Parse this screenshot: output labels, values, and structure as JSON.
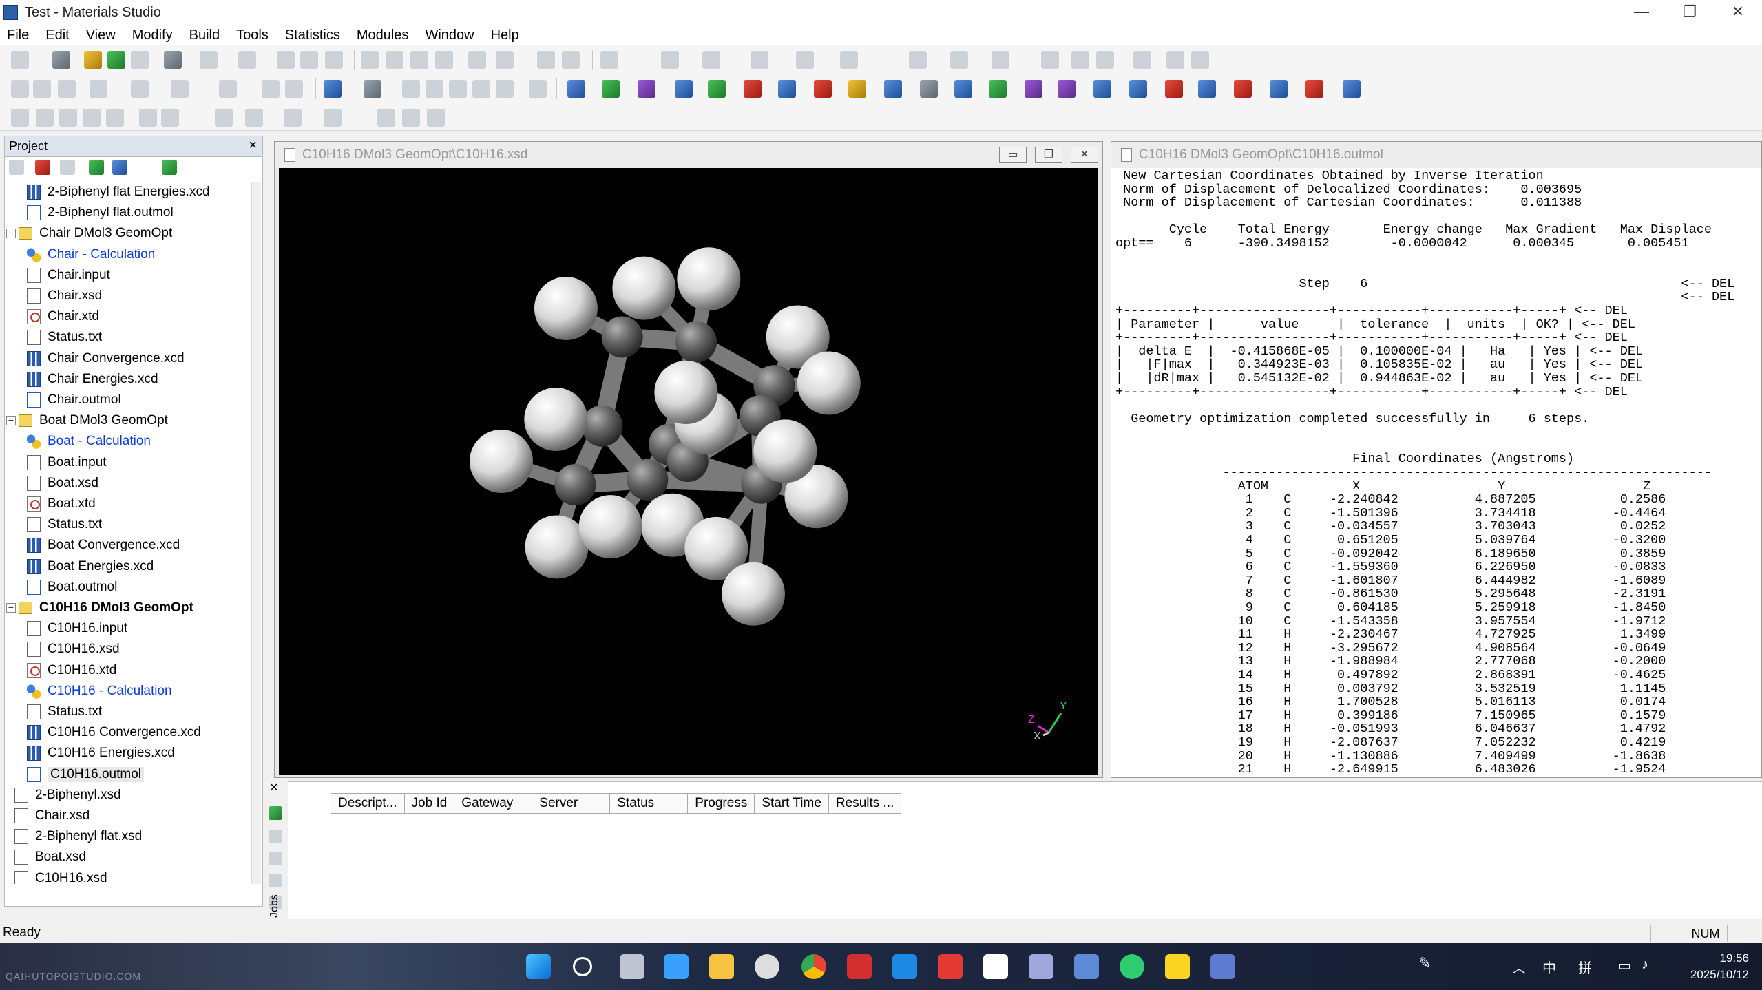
{
  "window": {
    "title": "Test - Materials Studio",
    "min": "—",
    "max": "❐",
    "close": "✕"
  },
  "menu": [
    "File",
    "Edit",
    "View",
    "Modify",
    "Build",
    "Tools",
    "Statistics",
    "Modules",
    "Window",
    "Help"
  ],
  "project": {
    "title": "Project",
    "close": "×",
    "tree": [
      {
        "label": "2-Biphenyl flat Energies.xcd",
        "icon": "chart-icon",
        "depth": 2
      },
      {
        "label": "2-Biphenyl flat.outmol",
        "icon": "outmol-icon",
        "depth": 2
      },
      {
        "label": "Chair DMol3 GeomOpt",
        "icon": "folder-icon",
        "depth": 1,
        "expander": "−"
      },
      {
        "label": "Chair - Calculation",
        "icon": "calculation-icon",
        "depth": 2,
        "style": "blue"
      },
      {
        "label": "Chair.input",
        "icon": "file-icon",
        "depth": 2
      },
      {
        "label": "Chair.xsd",
        "icon": "file-icon",
        "depth": 2
      },
      {
        "label": "Chair.xtd",
        "icon": "trajectory-icon",
        "depth": 2
      },
      {
        "label": "Status.txt",
        "icon": "file-icon",
        "depth": 2
      },
      {
        "label": "Chair Convergence.xcd",
        "icon": "chart-icon",
        "depth": 2
      },
      {
        "label": "Chair Energies.xcd",
        "icon": "chart-icon",
        "depth": 2
      },
      {
        "label": "Chair.outmol",
        "icon": "outmol-icon",
        "depth": 2
      },
      {
        "label": "Boat DMol3 GeomOpt",
        "icon": "folder-icon",
        "depth": 1,
        "expander": "−"
      },
      {
        "label": "Boat - Calculation",
        "icon": "calculation-icon",
        "depth": 2,
        "style": "blue"
      },
      {
        "label": "Boat.input",
        "icon": "file-icon",
        "depth": 2
      },
      {
        "label": "Boat.xsd",
        "icon": "file-icon",
        "depth": 2
      },
      {
        "label": "Boat.xtd",
        "icon": "trajectory-icon",
        "depth": 2
      },
      {
        "label": "Status.txt",
        "icon": "file-icon",
        "depth": 2
      },
      {
        "label": "Boat Convergence.xcd",
        "icon": "chart-icon",
        "depth": 2
      },
      {
        "label": "Boat Energies.xcd",
        "icon": "chart-icon",
        "depth": 2
      },
      {
        "label": "Boat.outmol",
        "icon": "outmol-icon",
        "depth": 2
      },
      {
        "label": "C10H16 DMol3 GeomOpt",
        "icon": "folder-icon",
        "depth": 1,
        "expander": "−",
        "style": "bold"
      },
      {
        "label": "C10H16.input",
        "icon": "file-icon",
        "depth": 2
      },
      {
        "label": "C10H16.xsd",
        "icon": "file-icon",
        "depth": 2
      },
      {
        "label": "C10H16.xtd",
        "icon": "trajectory-icon",
        "depth": 2
      },
      {
        "label": "C10H16 - Calculation",
        "icon": "calculation-icon",
        "depth": 2,
        "style": "blue"
      },
      {
        "label": "Status.txt",
        "icon": "file-icon",
        "depth": 2
      },
      {
        "label": "C10H16 Convergence.xcd",
        "icon": "chart-icon",
        "depth": 2
      },
      {
        "label": "C10H16 Energies.xcd",
        "icon": "chart-icon",
        "depth": 2
      },
      {
        "label": "C10H16.outmol",
        "icon": "outmol-icon",
        "depth": 2,
        "style": "selected"
      },
      {
        "label": "2-Biphenyl.xsd",
        "icon": "file-icon",
        "depth": 1
      },
      {
        "label": "Chair.xsd",
        "icon": "file-icon",
        "depth": 1
      },
      {
        "label": "2-Biphenyl flat.xsd",
        "icon": "file-icon",
        "depth": 1
      },
      {
        "label": "Boat.xsd",
        "icon": "file-icon",
        "depth": 1
      },
      {
        "label": "C10H16.xsd",
        "icon": "file-icon",
        "depth": 1
      }
    ]
  },
  "viewer": {
    "title": "C10H16 DMol3 GeomOpt\\C10H16.xsd",
    "axis_labels": {
      "y": "Y",
      "z": "Z",
      "x": "X"
    },
    "colors": {
      "background": "#000000",
      "carbon": "#6a6a6a",
      "hydrogen": "#e0e0e0"
    }
  },
  "output": {
    "title": "C10H16 DMol3 GeomOpt\\C10H16.outmol",
    "text": " New Cartesian Coordinates Obtained by Inverse Iteration\n Norm of Displacement of Delocalized Coordinates:    0.003695\n Norm of Displacement of Cartesian Coordinates:      0.011388\n\n       Cycle    Total Energy       Energy change   Max Gradient   Max Displace\nopt==    6      -390.3498152        -0.0000042      0.000345       0.005451\n\n\n                        Step    6                                         <-- DEL\n                                                                          <-- DEL\n+---------+-----------------+-----------+-----------+-----+ <-- DEL\n| Parameter |      value     |  tolerance  |  units  | OK? | <-- DEL\n+---------+-----------------+-----------+-----------+-----+ <-- DEL\n|  delta E  |  -0.415868E-05 |  0.100000E-04 |   Ha   | Yes | <-- DEL\n|   |F|max  |   0.344923E-03 |  0.105835E-02 |   au   | Yes | <-- DEL\n|   |dR|max |   0.545132E-02 |  0.944863E-02 |   au   | Yes | <-- DEL\n+---------+-----------------+-----------+-----------+-----+ <-- DEL\n\n  Geometry optimization completed successfully in     6 steps.\n\n\n                               Final Coordinates (Angstroms)\n              ----------------------------------------------------------------\n                ATOM           X                  Y                  Z\n                 1    C     -2.240842          4.887205           0.2586\n                 2    C     -1.501396          3.734418          -0.4464\n                 3    C     -0.034557          3.703043           0.0252\n                 4    C      0.651205          5.039764          -0.3200\n                 5    C     -0.092042          6.189650           0.3859\n                 6    C     -1.559360          6.226950          -0.0833\n                 7    C     -1.601807          6.444982          -1.6089\n                 8    C     -0.861530          5.295648          -2.3191\n                 9    C      0.604185          5.259918          -1.8450\n                10    C     -1.543358          3.957554          -1.9712\n                11    H     -2.230467          4.727925           1.3499\n                12    H     -3.295672          4.908564          -0.0649\n                13    H     -1.988984          2.777068          -0.2000\n                14    H      0.497892          2.868391          -0.4625\n                15    H      0.003792          3.532519           1.1145\n                16    H      1.700528          5.016113           0.0174\n                17    H      0.399186          7.150965           0.1579\n                18    H     -0.051993          6.046637           1.4792\n                19    H     -2.087637          7.052232           0.4219\n                20    H     -1.130886          7.409499          -1.8638\n                21    H     -2.649915          6.483026          -1.9524"
  },
  "jobs": {
    "side_label": "Jobs",
    "close": "×",
    "columns": [
      "Descript...",
      "Job Id",
      "Gateway",
      "Server",
      "Status",
      "Progress",
      "Start Time",
      "Results ..."
    ]
  },
  "status": {
    "ready": "Ready",
    "num": "NUM"
  },
  "taskbar": {
    "time": "19:56",
    "date": "2025/10/12",
    "ime": "中",
    "ime2": "拼",
    "wallpaper_text": "QAIHUTOPOISTUDIO.COM"
  }
}
